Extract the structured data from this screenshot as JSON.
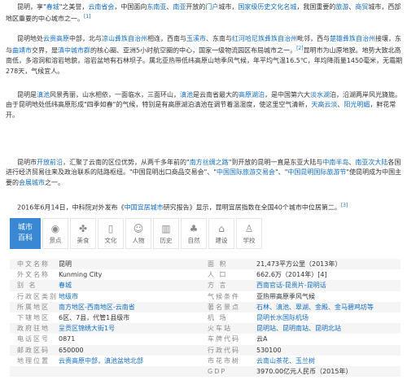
{
  "p1": {
    "t1": "昆明，享\"",
    "t2": "春城",
    "t3": "\"之美誉，",
    "t4": "云南省会",
    "t5": "，中国面向",
    "t6": "东南亚",
    "t7": "、",
    "t8": "南亚",
    "t9": "开放的",
    "t10": "门户",
    "t11": "城市，",
    "t12": "国家级历史文化名城",
    "t13": "，我国重要的",
    "t14": "旅游",
    "t15": "、",
    "t16": "商贸",
    "t17": "城市，西部地区重要的中心城市之一。",
    "ref": "[1]"
  },
  "p2": {
    "t1": "昆明地处",
    "t2": "云贵高原",
    "t3": "中部，北与",
    "t4": "凉山彝族自治州",
    "t5": "相连，西南与",
    "t6": "玉溪市",
    "t7": "、东南与",
    "t8": "红河哈尼族彝族自治州",
    "t9": "毗邻，西与",
    "t10": "楚雄彝族自治州",
    "t11": "接壤，东与",
    "t12": "曲靖市",
    "t13": "交界，是",
    "t14": "滇中城市群",
    "t15": "的核心圈、亚洲5小时航空圈的中心，国家一级物流园区布局城市之一。",
    "ref": "[2]",
    "t16": "昆明市为山原地貌。地势大致北高南低，多溶洞和溶岩地貌，溶岩盆地有石林坝子。属北亚热带低纬高原山地季风气候，年平均气温16.5℃，年均降雨量1450毫米，无霜期278天，气候宜人。"
  },
  "p3": {
    "t1": "昆明是",
    "t2": "滇池",
    "t3": "风景秀丽，山水相依，一面临水，三面环山，",
    "t4": "滇池",
    "t5": "是云南省最大的",
    "t6": "高原湖泊",
    "t7": "，是中国第六大",
    "t8": "淡水湖",
    "t9": "泊，沿湖两岸风光旖旎。由于昆明地处低纬高原形成\"四季如春\"的气候，特别是有高原湖泊滇池在调节着温湿度，使这里空气清新，",
    "t10": "天高云淡",
    "t11": "、",
    "t12": "阳光明媚",
    "t13": "，鲜花常开。"
  },
  "p4": {
    "t1": "昆明市",
    "t2": "开放前沿",
    "t3": "，汇聚了云南的区位优势，从两千多年前的\"",
    "t4": "南方丝绸之路",
    "t5": "\"到开放的昆明一直是东亚大陆与",
    "t6": "中南半岛",
    "t7": "、",
    "t8": "南亚次大陆",
    "t9": "各国进行经济贸易往来及政治联系的陆路枢纽。\"中国昆明出口商品交易会\"、\"",
    "t10": "中国国际旅游交易会",
    "t11": "\"、\"",
    "t12": "中国昆明国际旅游节",
    "t13": "\"使昆明成为中国主要的",
    "t14": "会展城市",
    "t15": "之一。"
  },
  "p5": {
    "t1": "2016年6月14日，中科院对外发布《",
    "t2": "中国宜居城市",
    "t3": "研究报告》显示，昆明宜居指数在全国40个城市中位居第二。",
    "ref": "[3]"
  },
  "city": {
    "logo_line1": "城市",
    "logo_line2": "百科",
    "cats": [
      {
        "icon": "◉",
        "label": "景点"
      },
      {
        "icon": "✤",
        "label": "美食"
      },
      {
        "icon": "▯",
        "label": "文化"
      },
      {
        "icon": "☺",
        "label": "人物"
      },
      {
        "icon": "▥",
        "label": "历史"
      },
      {
        "icon": "♣",
        "label": "自然"
      },
      {
        "icon": "⌂",
        "label": "建设"
      },
      {
        "icon": "♙",
        "label": "学校"
      }
    ]
  },
  "info": {
    "rows": [
      {
        "k": "中文名称",
        "v": "昆明",
        "k2": "面 积",
        "v2": "21,473平方公里（2013年）"
      },
      {
        "k": "外文名称",
        "v": "Kunming City",
        "k2": "人 口",
        "v2": "662.6万（2014年）[4]"
      },
      {
        "k": "别 名",
        "v": "春城",
        "k2": "方 言",
        "v2": "西南官话-昆贵片-昆明话"
      },
      {
        "k": "行政区类别",
        "v": "地级市",
        "k2": "气候条件",
        "v2": "亚热带高原季风气候"
      },
      {
        "k": "所属地区",
        "v": "南方地区-西南地区-云南省",
        "k2": "著名景点",
        "v2": "石林、滇池、翠湖、金殿、金马碧鸡坊等"
      },
      {
        "k": "下辖地区",
        "v": "6区、7县，代管1县级市",
        "k2": "机 场",
        "v2": "昆明长水国际机场"
      },
      {
        "k": "政府驻地",
        "v": "呈贡区锦绣大街1号",
        "k2": "火车站",
        "v2": "昆明站、昆明南站、昆明北站"
      },
      {
        "k": "电话区号",
        "v": "0871",
        "k2": "车牌代码",
        "v2": "云A"
      },
      {
        "k": "邮政区码",
        "v": "650000",
        "k2": "行政代码",
        "v2": "530100"
      },
      {
        "k": "地理位置",
        "v": "云贵高原中部，滇池盆地北部",
        "k2": "市花市树",
        "v2": "云南山茶花、玉兰树"
      },
      {
        "k": "",
        "v": "",
        "k2": "GDP",
        "v2": "3970.00亿元人民币（2015年）"
      }
    ]
  }
}
